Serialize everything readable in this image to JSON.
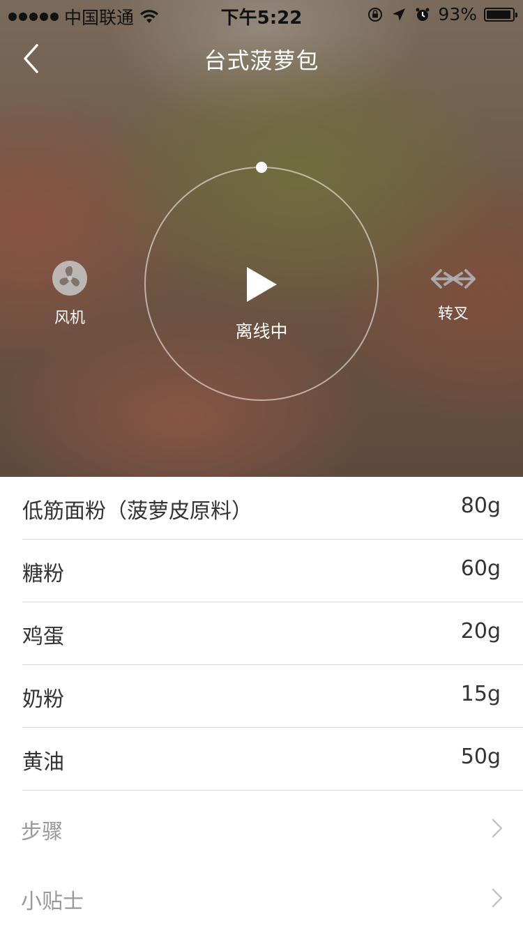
{
  "status_bar": {
    "carrier": "中国联通",
    "time": "下午5:22",
    "battery": "93%",
    "icons": [
      "signal-dots-icon",
      "wifi-icon",
      "rotation-lock-icon",
      "location-arrow-icon",
      "alarm-icon",
      "battery-icon"
    ]
  },
  "header": {
    "title": "台式菠萝包",
    "back_icon": "chevron-left-icon"
  },
  "controls": {
    "fan": {
      "label": "风机",
      "icon": "fan-icon"
    },
    "center": {
      "status": "离线中",
      "icon": "play-icon"
    },
    "rotisserie": {
      "label": "转叉",
      "icon": "rotisserie-icon"
    }
  },
  "ingredients": [
    {
      "name": "低筋面粉（菠萝皮原料）",
      "amount": "80g"
    },
    {
      "name": "糖粉",
      "amount": "60g"
    },
    {
      "name": "鸡蛋",
      "amount": "20g"
    },
    {
      "name": "奶粉",
      "amount": "15g"
    },
    {
      "name": "黄油",
      "amount": "50g"
    }
  ],
  "sections": [
    {
      "label": "步骤",
      "icon": "chevron-right-icon"
    },
    {
      "label": "小贴士",
      "icon": "chevron-right-icon"
    }
  ],
  "colors": {
    "title_text": "#ffffff",
    "ingredient_text": "#333333",
    "section_text": "#999999",
    "divider": "#d8d8d8"
  }
}
